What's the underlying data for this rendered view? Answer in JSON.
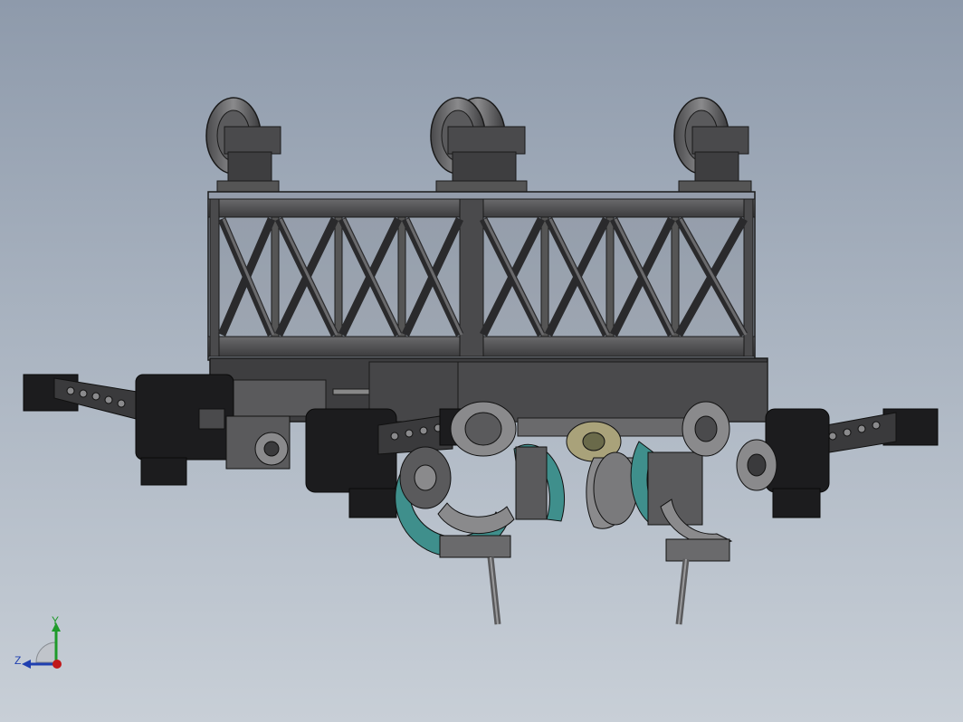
{
  "viewport": {
    "background_top": "#8e9aab",
    "background_bottom": "#c8cfd7"
  },
  "model": {
    "metal_dark": "#3a3a3c",
    "metal_mid": "#5a5a5c",
    "metal_light": "#8a8a8c",
    "gear_teal": "#3f8f8c",
    "brass": "#a9a27a",
    "black_part": "#1c1c1e"
  },
  "triad": {
    "y_label": "Y",
    "z_label": "Z",
    "y_color": "#1f9a2a",
    "z_color": "#1f3fb0",
    "x_color": "#c0181a"
  }
}
